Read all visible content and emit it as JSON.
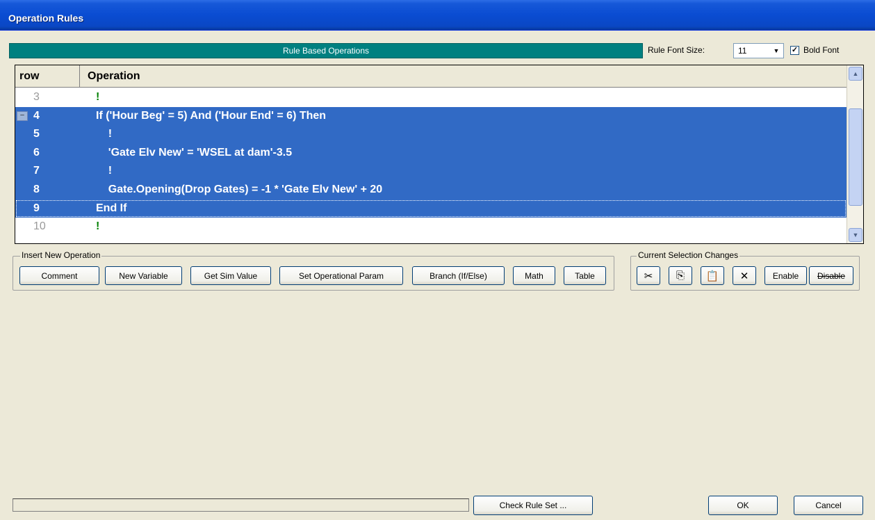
{
  "window": {
    "title": "Operation Rules"
  },
  "panel": {
    "header": "Rule Based Operations",
    "font_size_label": "Rule Font Size:",
    "font_size_value": "11",
    "bold_font_label": "Bold Font",
    "bold_font_checked": "✓"
  },
  "grid": {
    "col_row": "row",
    "col_operation": "Operation",
    "rows": [
      {
        "num": "3",
        "op": "!"
      },
      {
        "num": "4",
        "op": "If ('Hour Beg' = 5) And ('Hour End' = 6) Then"
      },
      {
        "num": "5",
        "op": "    !"
      },
      {
        "num": "6",
        "op": "    'Gate Elv New' = 'WSEL at dam'-3.5"
      },
      {
        "num": "7",
        "op": "    !"
      },
      {
        "num": "8",
        "op": "    Gate.Opening(Drop Gates) = -1 * 'Gate Elv New' + 20"
      },
      {
        "num": "9",
        "op": "End If"
      },
      {
        "num": "10",
        "op": "!"
      }
    ],
    "collapse_marker": "–"
  },
  "insert_group": {
    "label": "Insert New Operation",
    "buttons": [
      "Comment",
      "New Variable",
      "Get Sim Value",
      "Set Operational Param",
      "Branch (If/Else)",
      "Math",
      "Table"
    ]
  },
  "selection_group": {
    "label": "Current Selection Changes",
    "cut_icon": "✂",
    "copy_icon": "⎘",
    "paste_icon": "📋",
    "delete_icon": "✕",
    "enable_label": "Enable",
    "disable_label": "Disable"
  },
  "footer": {
    "check_rule_set": "Check Rule Set ...",
    "ok": "OK",
    "cancel": "Cancel"
  },
  "icons": {
    "scroll_up": "▲",
    "scroll_down": "▼",
    "dropdown": "▼"
  }
}
